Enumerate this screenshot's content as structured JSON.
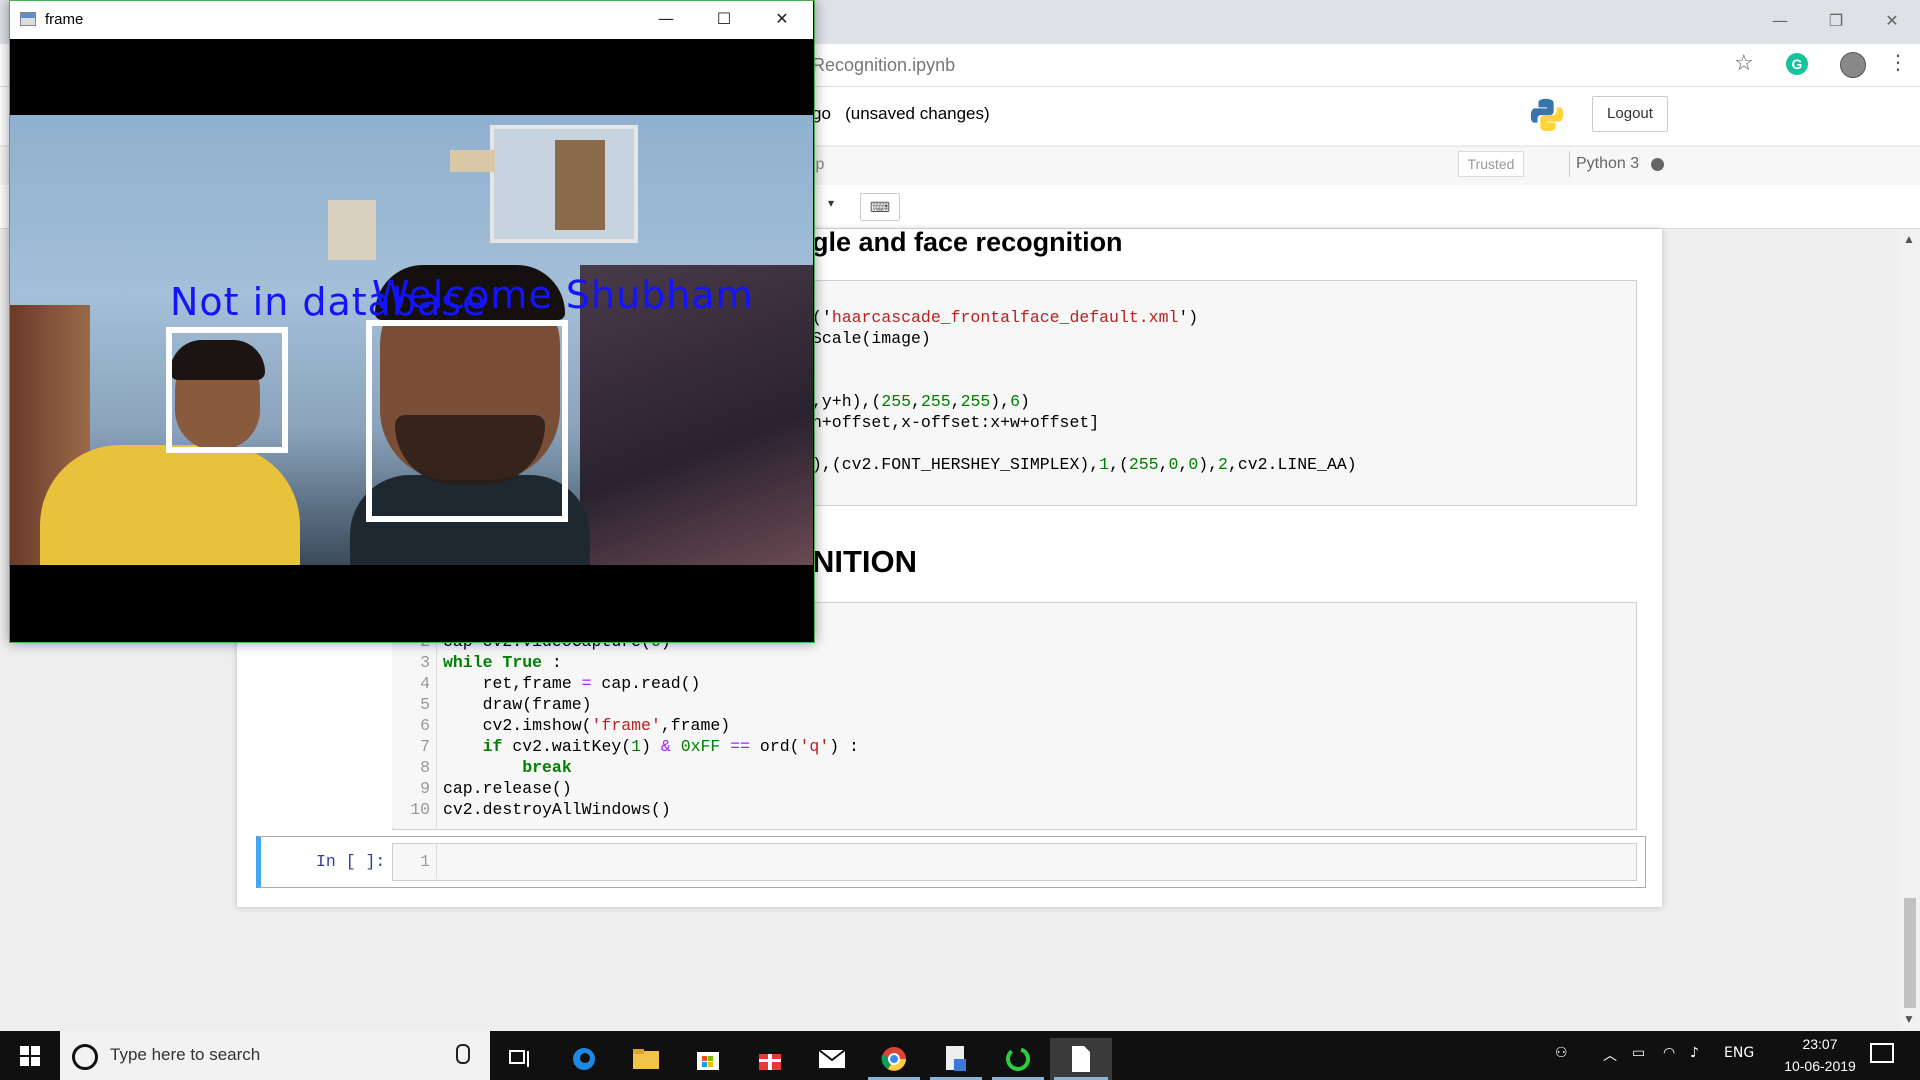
{
  "browser": {
    "address_url": "Recognition.ipynb",
    "window_controls": {
      "minimize": "—",
      "restore": "❐",
      "close": "✕"
    },
    "star": "☆",
    "grammarly": "G",
    "menu_dots": "⋮"
  },
  "jupyter": {
    "notebook_name": "go   (unsaved changes)",
    "logout_label": "Logout",
    "menu_help": "lp",
    "trusted_label": "Trusted",
    "kernel_name": "Python 3",
    "celltype_arrow": "▾",
    "keyboard_glyph": "⌨",
    "heading_1": "gle and face recognition",
    "heading_2": "NITION",
    "cell_1_lines": [
      {
        "parts": [
          [
            "",
            "('"
          ],
          [
            "str",
            "haarcascade_frontalface_default.xml"
          ],
          [
            "",
            "')"
          ]
        ]
      },
      {
        "parts": [
          [
            "",
            "Scale(image)"
          ]
        ]
      },
      {
        "parts": []
      },
      {
        "parts": []
      },
      {
        "parts": [
          [
            "",
            ",y+h),("
          ],
          [
            "num",
            "255"
          ],
          [
            "",
            ","
          ],
          [
            "num",
            "255"
          ],
          [
            "",
            ","
          ],
          [
            "num",
            "255"
          ],
          [
            "",
            "),"
          ],
          [
            "num",
            "6"
          ],
          [
            "",
            ")"
          ]
        ]
      },
      {
        "parts": [
          [
            "",
            "h+offset,x-offset:x+w+offset]"
          ]
        ]
      },
      {
        "parts": []
      },
      {
        "parts": [
          [
            "",
            "),(cv2.FONT_HERSHEY_SIMPLEX),"
          ],
          [
            "num",
            "1"
          ],
          [
            "",
            ",("
          ],
          [
            "num",
            "255"
          ],
          [
            "",
            ","
          ],
          [
            "num",
            "0"
          ],
          [
            "",
            ","
          ],
          [
            "num",
            "0"
          ],
          [
            "",
            "),"
          ],
          [
            "num",
            "2"
          ],
          [
            "",
            ",cv2.LINE_AA)"
          ]
        ]
      }
    ],
    "cell_2_lines": [
      {
        "n": "2",
        "parts": [
          [
            "",
            "cap=cv2.VideoCapture("
          ],
          [
            "num",
            "0"
          ],
          [
            "",
            ")"
          ]
        ]
      },
      {
        "n": "3",
        "parts": [
          [
            "kw",
            "while"
          ],
          [
            "",
            " "
          ],
          [
            "kw",
            "True"
          ],
          [
            "",
            " :"
          ]
        ]
      },
      {
        "n": "4",
        "parts": [
          [
            "",
            "    ret,frame "
          ],
          [
            "op",
            "="
          ],
          [
            "",
            " cap.read()"
          ]
        ]
      },
      {
        "n": "5",
        "parts": [
          [
            "",
            "    draw(frame)"
          ]
        ]
      },
      {
        "n": "6",
        "parts": [
          [
            "",
            "    cv2.imshow("
          ],
          [
            "str",
            "'frame'"
          ],
          [
            "",
            ",frame)"
          ]
        ]
      },
      {
        "n": "7",
        "parts": [
          [
            "",
            "    "
          ],
          [
            "kw",
            "if"
          ],
          [
            "",
            " cv2.waitKey("
          ],
          [
            "num",
            "1"
          ],
          [
            "",
            ") "
          ],
          [
            "op",
            "&"
          ],
          [
            "",
            " "
          ],
          [
            "num",
            "0xFF"
          ],
          [
            "",
            " "
          ],
          [
            "op",
            "=="
          ],
          [
            "",
            " ord("
          ],
          [
            "str",
            "'q'"
          ],
          [
            "",
            ") :"
          ]
        ]
      },
      {
        "n": "8",
        "parts": [
          [
            "",
            "        "
          ],
          [
            "kw",
            "break"
          ]
        ]
      },
      {
        "n": "9",
        "parts": [
          [
            "",
            "cap.release()"
          ]
        ]
      },
      {
        "n": "10",
        "parts": [
          [
            "",
            "cv2.destroyAllWindows()"
          ]
        ]
      }
    ],
    "prompt_3": "In [ ]:",
    "cell_3_line": "1"
  },
  "frame_window": {
    "title": "frame",
    "controls": {
      "minimize": "—",
      "maximize": "☐",
      "close": "✕"
    },
    "label_1": "Not in database",
    "label_2": "Welcome Shubham"
  },
  "taskbar": {
    "search_placeholder": "Type here to search",
    "language": "ENG",
    "time": "23:07",
    "date": "10-06-2019"
  },
  "colors": {
    "accent_blue": "#42a5f5",
    "opencv_label": "#1313ff",
    "grammarly": "#15c39a"
  }
}
